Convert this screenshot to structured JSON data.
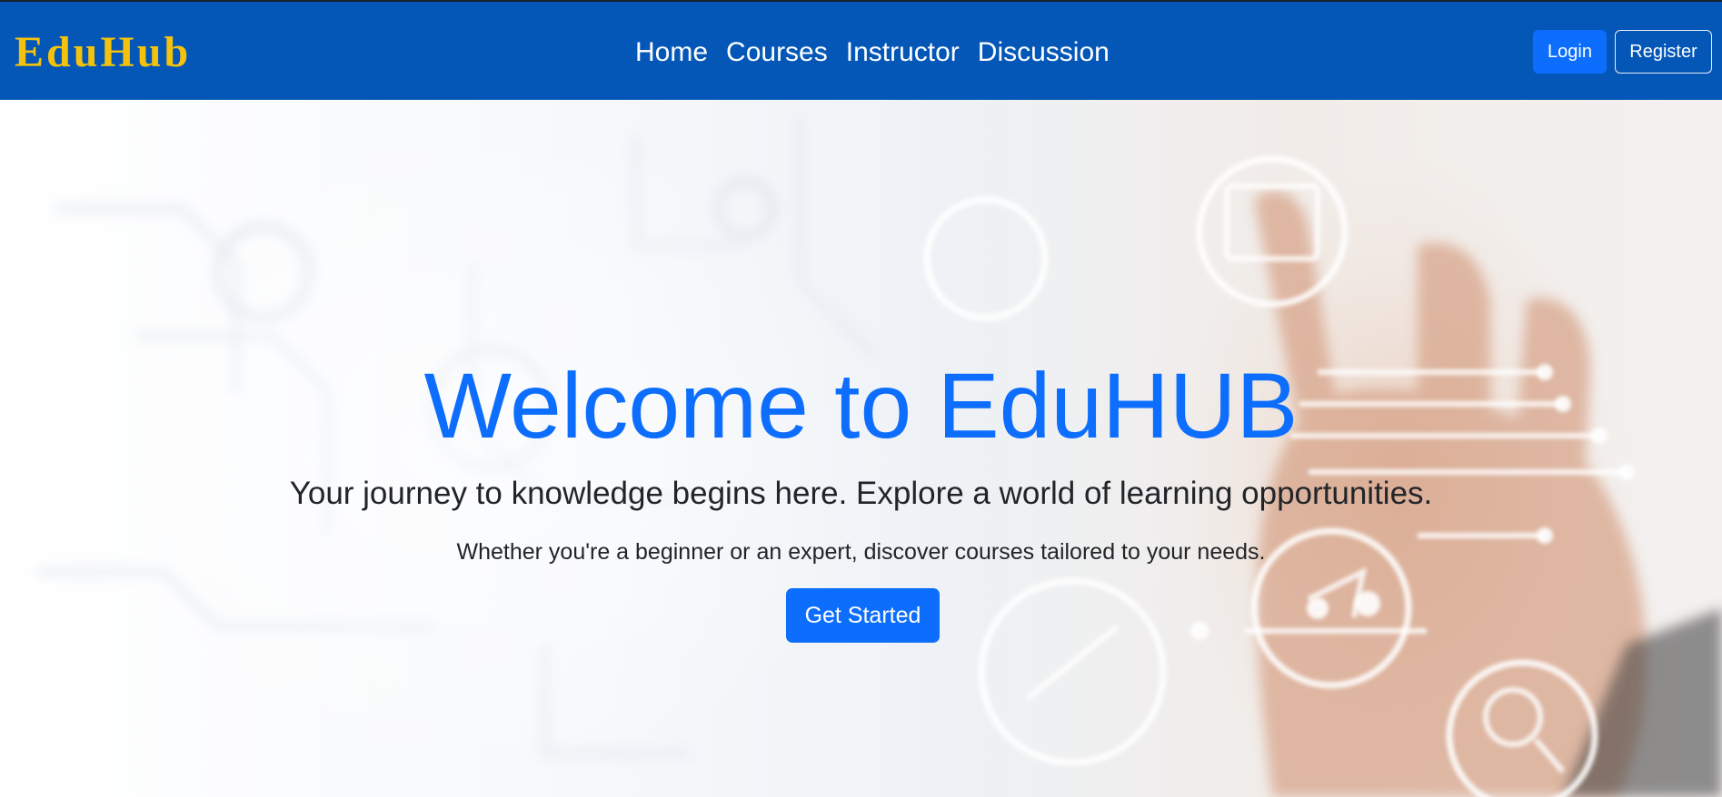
{
  "brand": "EduHub",
  "nav": {
    "links": [
      "Home",
      "Courses",
      "Instructor",
      "Discussion"
    ]
  },
  "auth": {
    "login_label": "Login",
    "register_label": "Register"
  },
  "hero": {
    "title": "Welcome to EduHUB",
    "subtitle": "Your journey to knowledge begins here. Explore a world of learning opportunities.",
    "tagline": "Whether you're a beginner or an expert, discover courses tailored to your needs.",
    "cta_label": "Get Started",
    "background_icon": "hand-touching-circuit-icons-icon"
  },
  "colors": {
    "navbar": "#0457b7",
    "brand": "#f4c20d",
    "primary": "#0d6efd",
    "text": "#212529"
  }
}
